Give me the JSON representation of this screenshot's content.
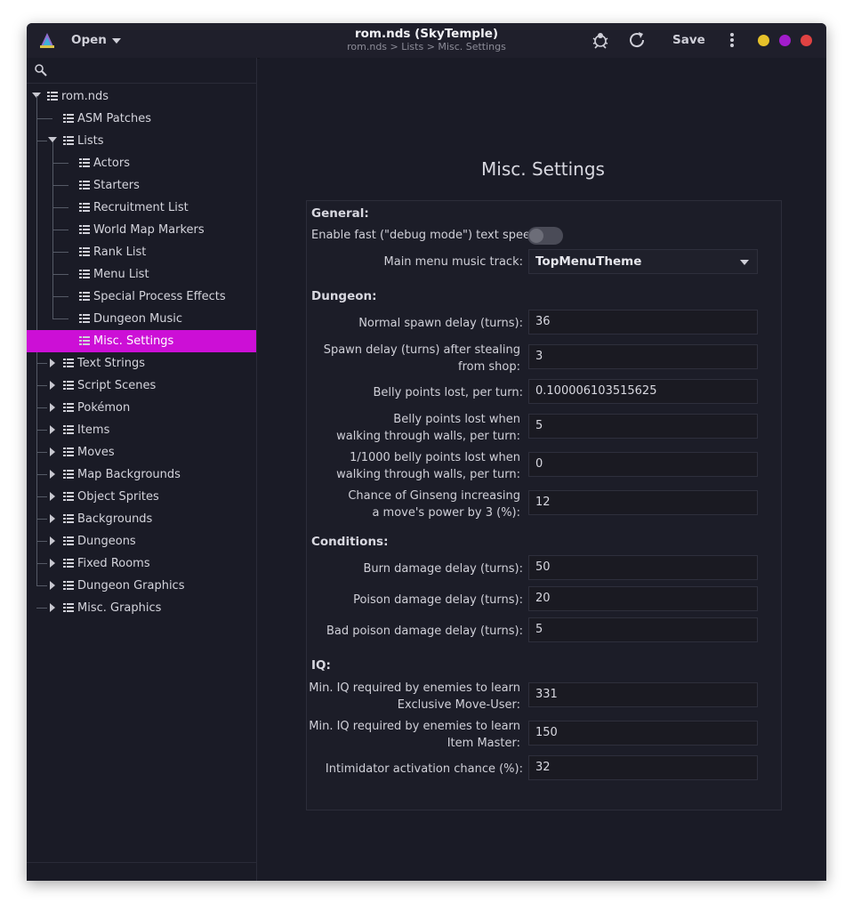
{
  "titlebar": {
    "open_label": "Open",
    "title": "rom.nds (SkyTemple)",
    "subtitle": "rom.nds > Lists > Misc. Settings",
    "save_label": "Save",
    "dots": [
      "#e6c12a",
      "#a21ccc",
      "#e04242"
    ]
  },
  "sidebar": {
    "root": "rom.nds",
    "items": [
      {
        "label": "ASM Patches",
        "icon": "patch-icon"
      },
      {
        "label": "Lists",
        "icon": "list-icon"
      },
      {
        "label": "Actors",
        "icon": "actor-icon"
      },
      {
        "label": "Starters",
        "icon": "pokemon-icon"
      },
      {
        "label": "Recruitment List",
        "icon": "pokemon-icon"
      },
      {
        "label": "World Map Markers",
        "icon": "map-icon"
      },
      {
        "label": "Rank List",
        "icon": "list-icon"
      },
      {
        "label": "Menu List",
        "icon": "list-icon"
      },
      {
        "label": "Special Process Effects",
        "icon": "list-icon"
      },
      {
        "label": "Dungeon Music",
        "icon": "music-icon"
      },
      {
        "label": "Misc. Settings",
        "icon": "list-icon"
      },
      {
        "label": "Text Strings",
        "icon": "speech-icon"
      },
      {
        "label": "Script Scenes",
        "icon": "scene-icon"
      },
      {
        "label": "Pokémon",
        "icon": "pokemon-icon"
      },
      {
        "label": "Items",
        "icon": "item-icon"
      },
      {
        "label": "Moves",
        "icon": "moves-icon"
      },
      {
        "label": "Map Backgrounds",
        "icon": "map-icon"
      },
      {
        "label": "Object Sprites",
        "icon": "cube-icon"
      },
      {
        "label": "Backgrounds",
        "icon": "image-icon"
      },
      {
        "label": "Dungeons",
        "icon": "dungeon-icon"
      },
      {
        "label": "Fixed Rooms",
        "icon": "rooms-icon"
      },
      {
        "label": "Dungeon Graphics",
        "icon": "tiles-icon"
      },
      {
        "label": "Misc. Graphics",
        "icon": "graphics-icon"
      }
    ]
  },
  "main": {
    "title": "Misc. Settings",
    "general": {
      "header": "General:",
      "fast_text_label": "Enable fast (\"debug mode\") text speed:",
      "music_label": "Main menu music track:",
      "music_value": "TopMenuTheme"
    },
    "dungeon": {
      "header": "Dungeon:",
      "fields": [
        {
          "label1": "Normal spawn delay (turns):",
          "label2": "",
          "value": "36"
        },
        {
          "label1": "Spawn delay (turns) after stealing",
          "label2": "from shop:",
          "value": "3"
        },
        {
          "label1": "Belly points lost, per turn:",
          "label2": "",
          "value": "0.100006103515625"
        },
        {
          "label1": "Belly points lost when",
          "label2": "walking through walls, per turn:",
          "value": "5"
        },
        {
          "label1": "1/1000 belly points lost when",
          "label2": "walking through walls, per turn:",
          "value": "0"
        },
        {
          "label1": "Chance of Ginseng increasing",
          "label2": "a move's power by 3 (%):",
          "value": "12"
        }
      ]
    },
    "conditions": {
      "header": "Conditions:",
      "fields": [
        {
          "label1": "Burn damage delay (turns):",
          "value": "50"
        },
        {
          "label1": "Poison damage delay (turns):",
          "value": "20"
        },
        {
          "label1": "Bad poison damage delay (turns):",
          "value": "5"
        }
      ]
    },
    "iq": {
      "header": "IQ:",
      "fields": [
        {
          "label1": "Min. IQ required by enemies to learn",
          "label2": "Exclusive Move-User:",
          "value": "331"
        },
        {
          "label1": "Min. IQ required by enemies to learn",
          "label2": "Item Master:",
          "value": "150"
        },
        {
          "label1": "Intimidator activation chance (%):",
          "label2": "",
          "value": "32"
        }
      ]
    }
  }
}
